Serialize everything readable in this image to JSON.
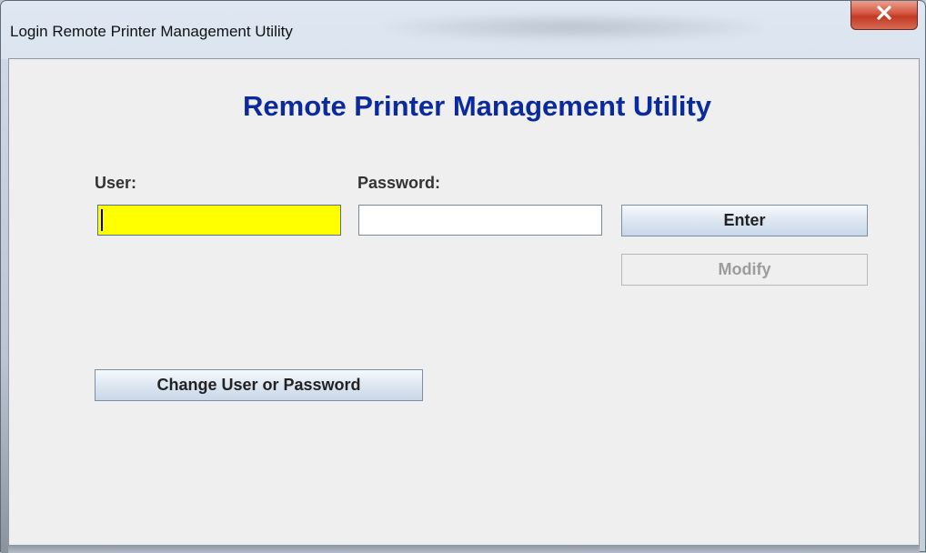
{
  "window": {
    "title": "Login Remote Printer Management Utility",
    "close_icon": "close-icon"
  },
  "main": {
    "heading": "Remote Printer Management Utility",
    "user_label": "User:",
    "password_label": "Password:",
    "user_value": "",
    "password_value": "",
    "enter_label": "Enter",
    "modify_label": "Modify",
    "change_label": "Change User or Password"
  },
  "colors": {
    "heading": "#0a2a9e",
    "user_field_bg": "#ffff00",
    "close_button": "#c03a23"
  }
}
